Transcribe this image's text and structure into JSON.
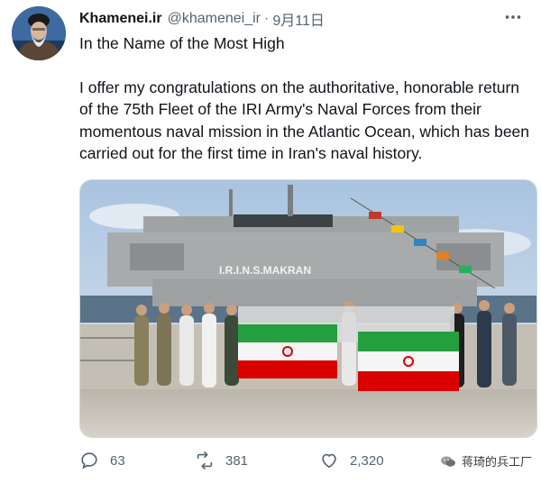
{
  "tweet": {
    "author_name": "Khamenei.ir",
    "author_handle": "@khamenei_ir",
    "separator": "·",
    "date": "9月11日",
    "paragraph_1": "In the Name of the Most High",
    "paragraph_2": "I offer my congratulations on the authoritative, honorable return of the 75th Fleet of the IRI Army's Naval Forces from their momentous naval mission in the Atlantic Ocean, which has been carried out for the first time in Iran's naval history."
  },
  "media": {
    "ship_name": "I.R.I.N.S.MAKRAN"
  },
  "actions": {
    "reply_count": "63",
    "retweet_count": "381",
    "like_count": "2,320"
  },
  "watermark": {
    "text": "蒋琦的兵工厂"
  },
  "icons": [
    "reply-icon",
    "retweet-icon",
    "like-icon",
    "more-icon",
    "wechat-icon"
  ]
}
